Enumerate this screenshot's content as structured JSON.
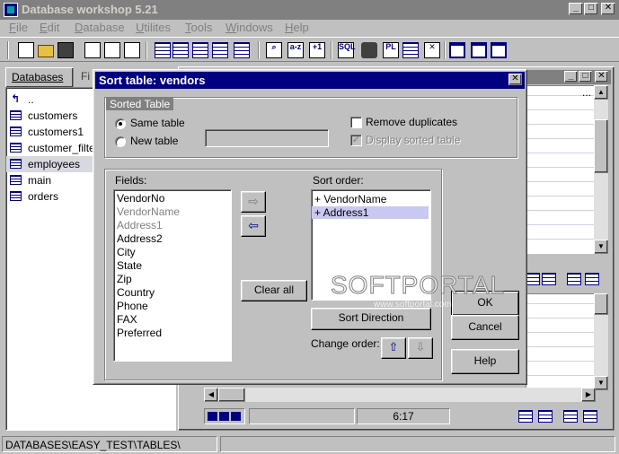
{
  "app": {
    "title": "Database workshop 5.21"
  },
  "menu": [
    {
      "label": "File",
      "key": "F",
      "rest": "ile"
    },
    {
      "label": "Edit",
      "key": "E",
      "rest": "dit"
    },
    {
      "label": "Database",
      "key": "D",
      "rest": "atabase"
    },
    {
      "label": "Utilites",
      "key": "U",
      "rest": "tilites"
    },
    {
      "label": "Tools",
      "key": "T",
      "rest": "ools"
    },
    {
      "label": "Windows",
      "key": "W",
      "rest": "indows"
    },
    {
      "label": "Help",
      "key": "H",
      "rest": "elp"
    }
  ],
  "left_panel": {
    "tabs": [
      "Databases",
      "Fi"
    ],
    "items": [
      {
        "label": "..",
        "icon": "up-arrow-icon"
      },
      {
        "label": "customers",
        "icon": "table-icon"
      },
      {
        "label": "customers1",
        "icon": "table-icon"
      },
      {
        "label": "customer_filter",
        "icon": "table-icon"
      },
      {
        "label": "employees",
        "icon": "table-icon"
      },
      {
        "label": "main",
        "icon": "table-icon"
      },
      {
        "label": "orders",
        "icon": "table-icon"
      }
    ]
  },
  "child_window": {
    "time": "6:17",
    "ellipsis": "..."
  },
  "dialog": {
    "title": "Sort table: vendors",
    "sorted_table_group": "Sorted Table",
    "same_table": "Same table",
    "new_table": "New table",
    "remove_duplicates": "Remove duplicates",
    "display_sorted": "Display sorted table",
    "fields_label": "Fields:",
    "sort_order_label": "Sort order:",
    "fields": [
      {
        "name": "VendorNo",
        "disabled": false
      },
      {
        "name": "VendorName",
        "disabled": true
      },
      {
        "name": "Address1",
        "disabled": true
      },
      {
        "name": "Address2",
        "disabled": false
      },
      {
        "name": "City",
        "disabled": false
      },
      {
        "name": "State",
        "disabled": false
      },
      {
        "name": "Zip",
        "disabled": false
      },
      {
        "name": "Country",
        "disabled": false
      },
      {
        "name": "Phone",
        "disabled": false
      },
      {
        "name": "FAX",
        "disabled": false
      },
      {
        "name": "Preferred",
        "disabled": false
      }
    ],
    "sort_order": [
      "+ VendorName",
      "+ Address1"
    ],
    "clear_all": "Clear all",
    "sort_direction": "Sort Direction",
    "change_order": "Change order:",
    "ok": "OK",
    "cancel": "Cancel",
    "help": "Help"
  },
  "watermark": {
    "main": "SOFTPORTAL",
    "url": "www.softportal.com"
  },
  "status": {
    "path": "DATABASES\\EASY_TEST\\TABLES\\"
  }
}
